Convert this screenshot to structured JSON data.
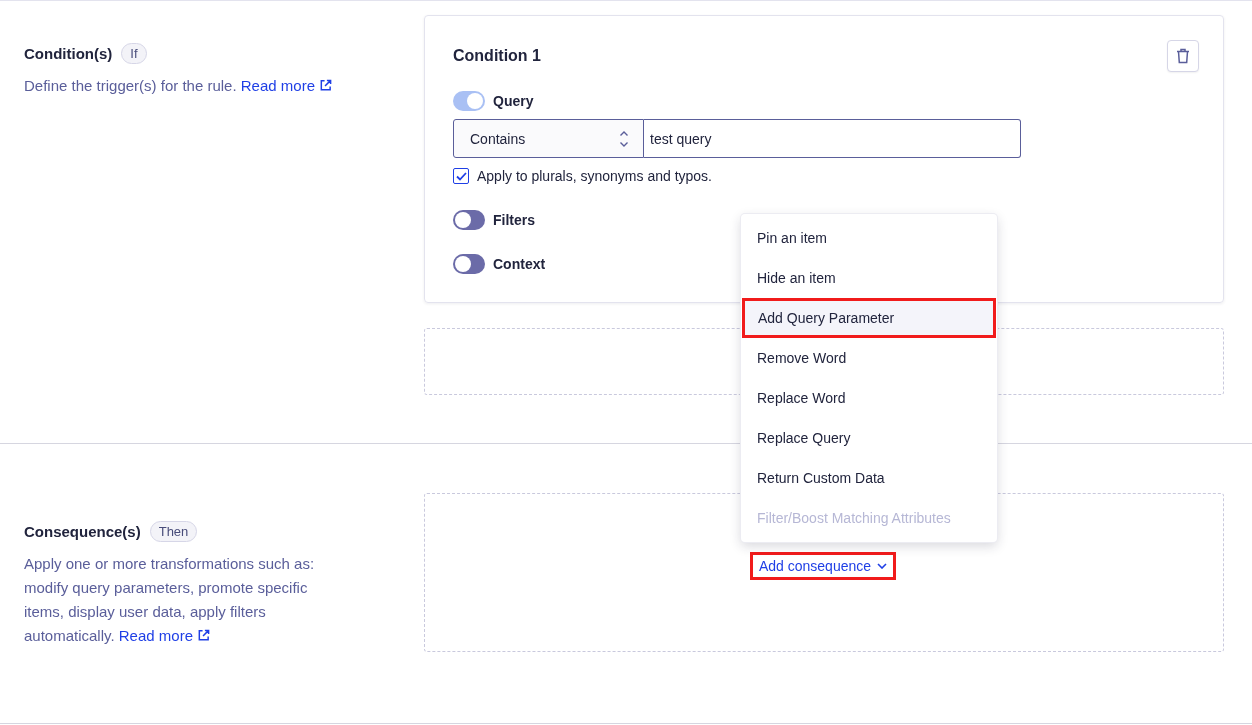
{
  "conditions": {
    "title": "Condition(s)",
    "badge": "If",
    "description": "Define the trigger(s) for the rule.",
    "link": "Read more"
  },
  "condition_card": {
    "title": "Condition 1",
    "query_toggle": {
      "label": "Query",
      "on": true
    },
    "operator": "Contains",
    "query": "test query",
    "apply_checkbox": {
      "label": "Apply to plurals, synonyms and typos.",
      "checked": true
    },
    "toggles": [
      {
        "label": "Filters",
        "on": false
      },
      {
        "label": "Context",
        "on": false
      }
    ]
  },
  "consequences": {
    "title": "Consequence(s)",
    "badge": "Then",
    "description": "Apply one or more transformations such as: modify query parameters, promote specific items, display user data, apply filters automatically.",
    "link": "Read more"
  },
  "add_consequence": {
    "label": "Add consequence",
    "highlighted": true
  },
  "menu": [
    {
      "label": "Pin an item",
      "disabled": false,
      "highlighted": false
    },
    {
      "label": "Hide an item",
      "disabled": false,
      "highlighted": false
    },
    {
      "label": "Add Query Parameter",
      "disabled": false,
      "highlighted": true
    },
    {
      "label": "Remove Word",
      "disabled": false,
      "highlighted": false
    },
    {
      "label": "Replace Word",
      "disabled": false,
      "highlighted": false
    },
    {
      "label": "Replace Query",
      "disabled": false,
      "highlighted": false
    },
    {
      "label": "Return Custom Data",
      "disabled": false,
      "highlighted": false
    },
    {
      "label": "Filter/Boost Matching Attributes",
      "disabled": true,
      "highlighted": false
    }
  ]
}
